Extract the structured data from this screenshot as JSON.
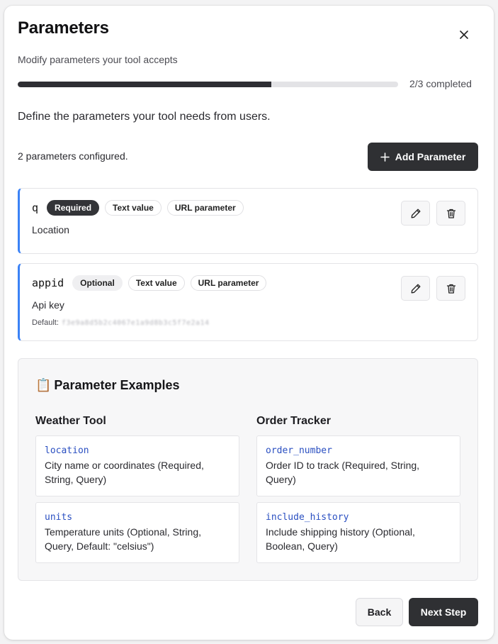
{
  "dialog": {
    "title": "Parameters",
    "subtitle": "Modify parameters your tool accepts",
    "close_icon": "close-icon"
  },
  "progress": {
    "completed": 2,
    "total": 3,
    "fraction": 0.667,
    "label": "2/3 completed"
  },
  "intro": "Define the parameters your tool needs from users.",
  "parameters": {
    "count_text": "2 parameters configured.",
    "add_label": "Add Parameter",
    "items": [
      {
        "name": "q",
        "status": "Required",
        "type": "Text value",
        "location": "URL parameter",
        "description": "Location"
      },
      {
        "name": "appid",
        "status": "Optional",
        "type": "Text value",
        "location": "URL parameter",
        "description": "Api key",
        "default_label": "Default:",
        "default_value": "f3e9a8d5b2c4067e1a9d8b3c5f7e2a14"
      }
    ]
  },
  "examples": {
    "title_emoji": "📋",
    "title": "Parameter Examples",
    "columns": [
      {
        "title": "Weather Tool",
        "items": [
          {
            "code": "location",
            "desc": "City name or coordinates (Required, String, Query)"
          },
          {
            "code": "units",
            "desc": "Temperature units (Optional, String, Query, Default: \"celsius\")"
          }
        ]
      },
      {
        "title": "Order Tracker",
        "items": [
          {
            "code": "order_number",
            "desc": "Order ID to track (Required, String, Query)"
          },
          {
            "code": "include_history",
            "desc": "Include shipping history (Optional, Boolean, Query)"
          }
        ]
      }
    ]
  },
  "footer": {
    "back_label": "Back",
    "next_label": "Next Step"
  },
  "colors": {
    "accent": "#3b82f6",
    "primary_button": "#2f3033",
    "code_text": "#2a4fc1"
  }
}
